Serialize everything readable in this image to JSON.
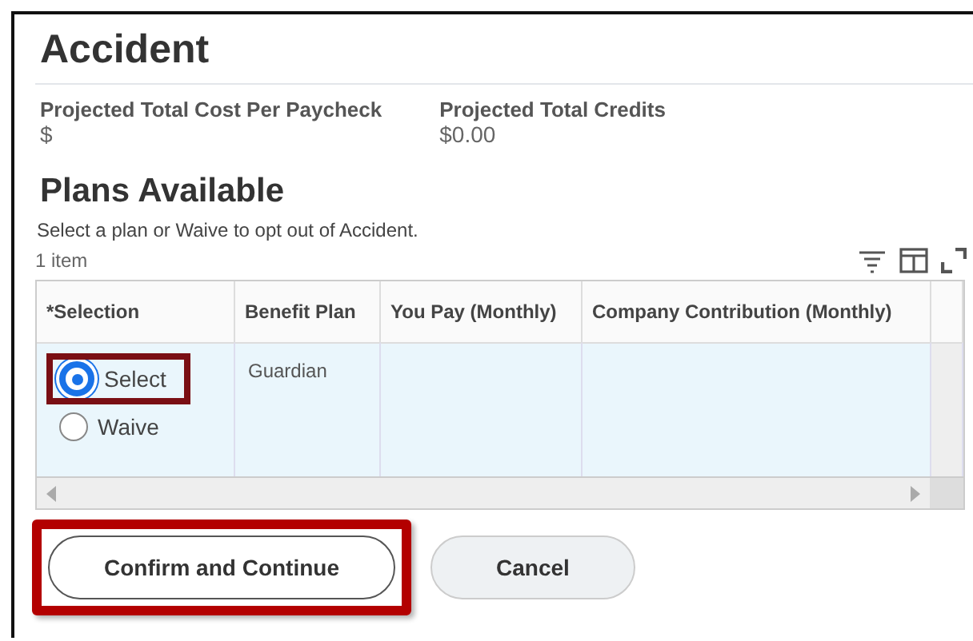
{
  "title": "Accident",
  "summary": [
    {
      "label": "Projected Total Cost Per Paycheck",
      "value": "$"
    },
    {
      "label": "Projected Total Credits",
      "value": "$0.00"
    }
  ],
  "section": {
    "heading": "Plans Available",
    "instruction": "Select a plan or Waive to opt out of Accident.",
    "item_count": "1 item"
  },
  "table": {
    "columns": [
      "*Selection",
      "Benefit Plan",
      "You Pay (Monthly)",
      "Company Contribution (Monthly)"
    ],
    "rows": [
      {
        "options": [
          {
            "label": "Select",
            "selected": true,
            "highlighted": true
          },
          {
            "label": "Waive",
            "selected": false,
            "highlighted": false
          }
        ],
        "benefit_plan": "Guardian"
      }
    ]
  },
  "buttons": [
    {
      "label": "Confirm and Continue",
      "kind": "primary",
      "highlighted": true
    },
    {
      "label": "Cancel",
      "kind": "secondary",
      "highlighted": false
    }
  ]
}
